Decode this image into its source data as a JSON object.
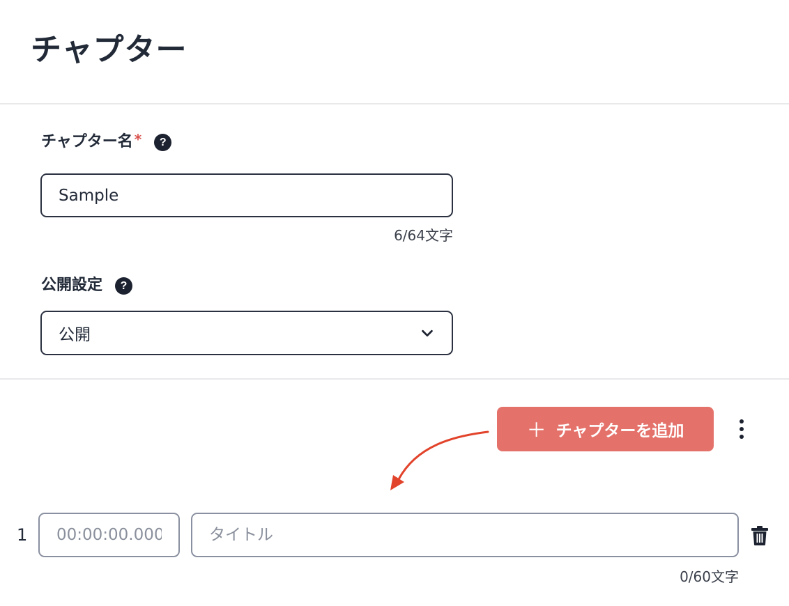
{
  "page": {
    "title": "チャプター"
  },
  "form": {
    "chapter_name": {
      "label": "チャプター名",
      "required_mark": "*",
      "help_glyph": "?",
      "value": "Sample",
      "counter": "6/64文字"
    },
    "visibility": {
      "label": "公開設定",
      "help_glyph": "?",
      "selected": "公開"
    }
  },
  "toolbar": {
    "add_chapter_plus": "＋",
    "add_chapter_label": "チャプターを追加",
    "accent_color": "#e4716a",
    "annotation_arrow_color": "#e2432b"
  },
  "chapters": [
    {
      "index": "1",
      "time_placeholder": "00:00:00.000",
      "title_placeholder": "タイトル",
      "counter": "0/60文字"
    }
  ],
  "icons": {
    "help": "question-circle-icon",
    "select": "chevron-down-icon",
    "add": "plus-icon",
    "menu": "kebab-icon",
    "delete": "trash-icon"
  }
}
